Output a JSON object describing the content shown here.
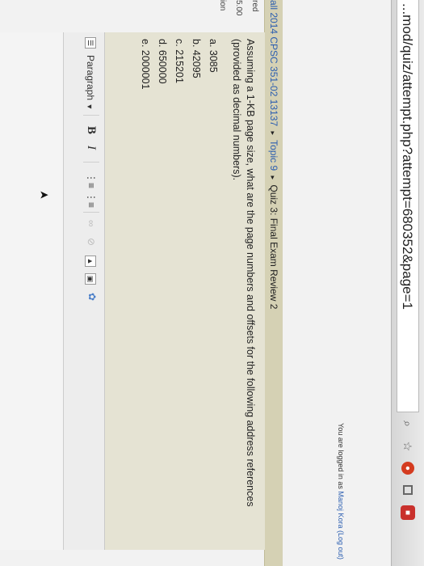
{
  "browser": {
    "url": "...mod/quiz/attempt.php?attempt=680352&page=1"
  },
  "login": {
    "prefix": "You are logged in as",
    "user": "Manoj Kora",
    "logout": "(Log out)"
  },
  "breadcrumb": {
    "course": "all 2014 CPSC 351-02 13137",
    "topic": "Topic 9",
    "quiz": "Quiz 3: Final Exam Review 2",
    "sep": "▸"
  },
  "sidebar": {
    "line1": "red",
    "line2": "5.00",
    "line3": "ion"
  },
  "question": {
    "text": "Assuming a 1-KB page size, what are the page numbers and offsets for the following address references (provided as decimal numbers).",
    "answers": [
      "a. 3085",
      "b. 42095",
      "c. 215201",
      "d. 650000",
      "e. 2000001"
    ]
  },
  "editor": {
    "format_label": "Paragraph",
    "bold_label": "B",
    "italic_label": "I",
    "ul_icon": "bullet-list-icon",
    "ol_icon": "numbered-list-icon",
    "link_icon": "link-icon",
    "unlink_icon": "unlink-icon",
    "image_icon": "image-icon",
    "media_icon": "media-icon",
    "spellcheck_icon": "spellcheck-icon"
  },
  "colors": {
    "breadcrumb_bg": "#d5d1b4",
    "question_bg": "#e5e3d3",
    "link": "#2a5db0"
  }
}
